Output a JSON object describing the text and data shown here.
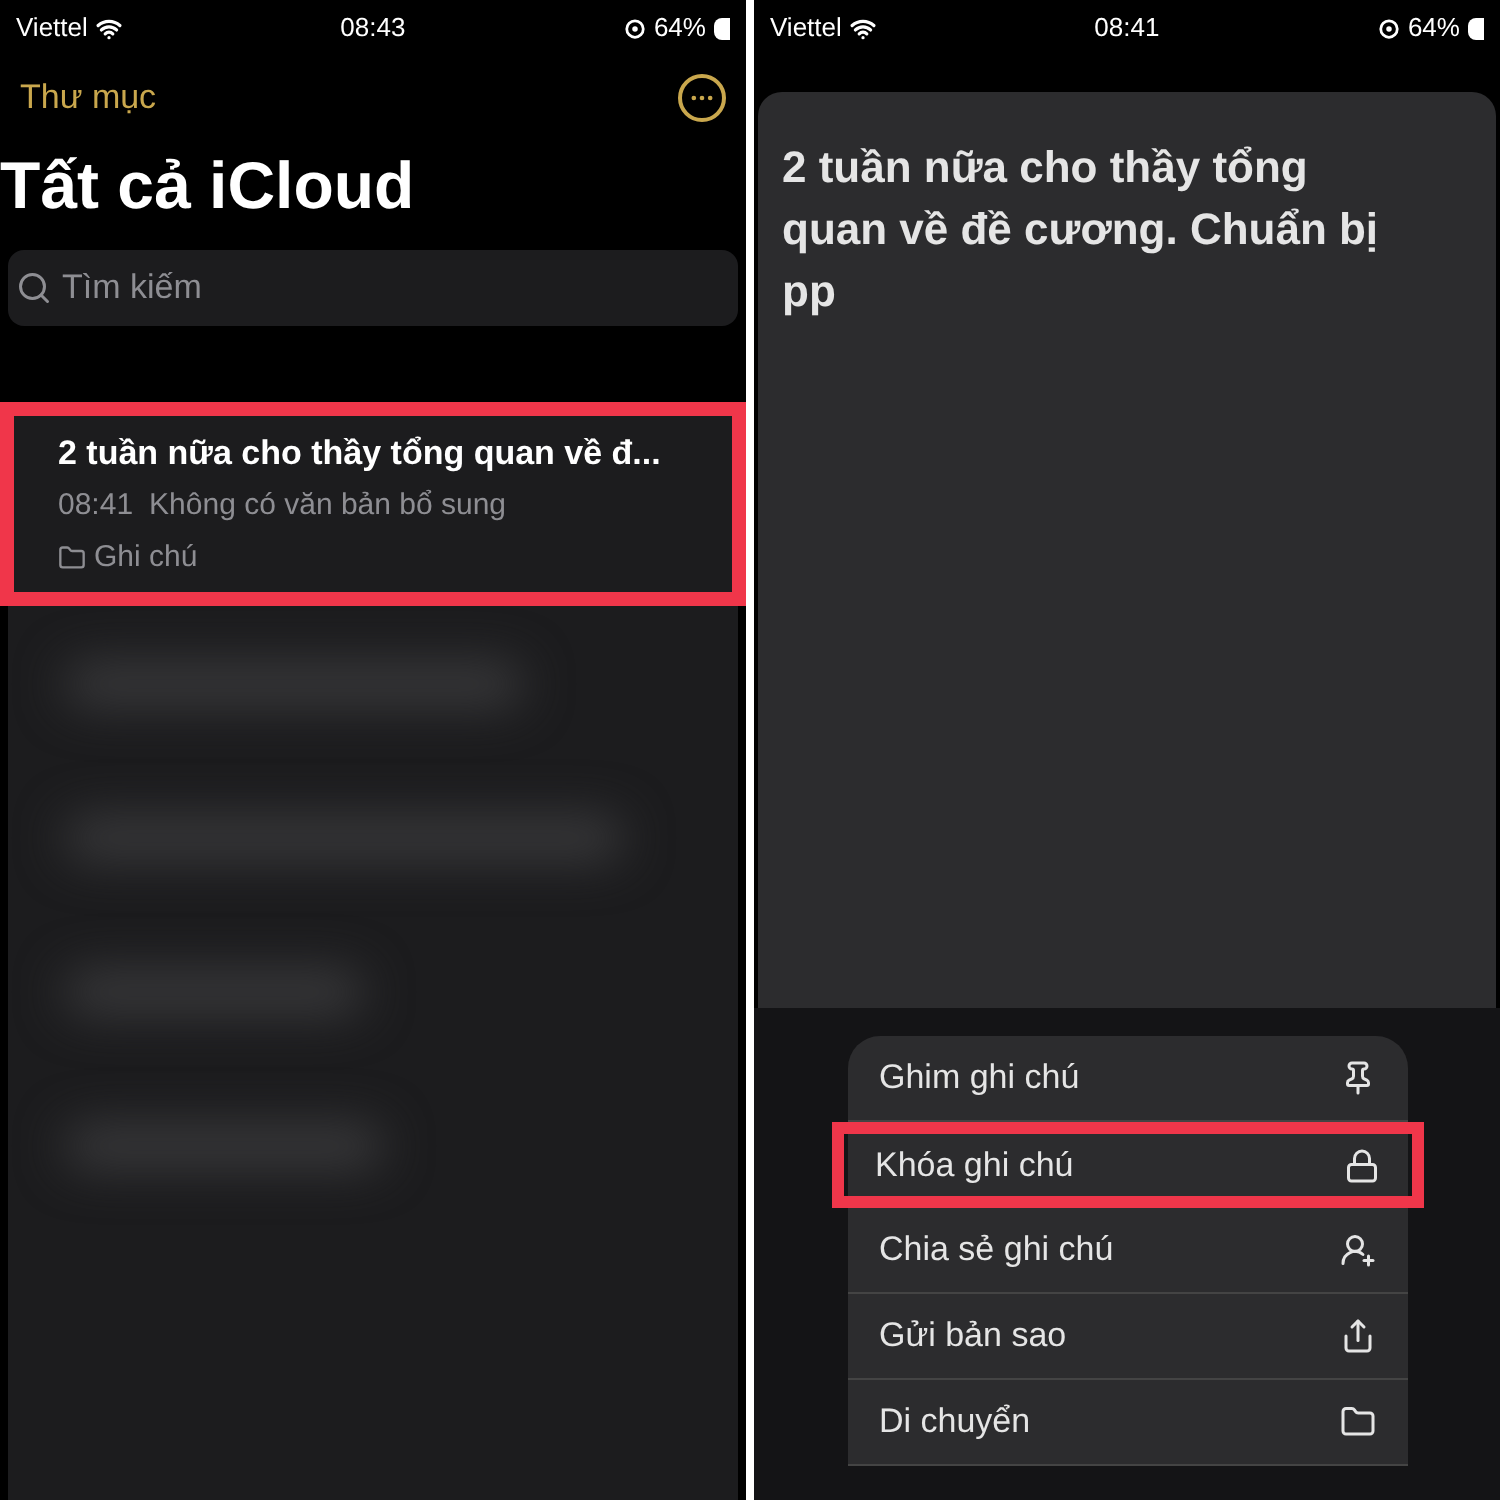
{
  "left_screen": {
    "status_bar": {
      "carrier": "Viettel",
      "time": "08:43",
      "battery": "64%"
    },
    "back_link": "Thư mục",
    "title": "Tất cả iCloud",
    "search": {
      "placeholder": "Tìm kiếm"
    },
    "notes": [
      {
        "title": "2 tuần nữa cho thầy tổng quan về đ...",
        "time": "08:41",
        "preview": "Không có văn bản bổ sung",
        "folder": "Ghi chú",
        "highlighted": true
      }
    ]
  },
  "right_screen": {
    "status_bar": {
      "carrier": "Viettel",
      "time": "08:41",
      "battery": "64%"
    },
    "note_preview": "2 tuần nữa cho thầy tổng quan về đề cương. Chuẩn bị pp",
    "menu": [
      {
        "label": "Ghim ghi chú",
        "kind": "pin",
        "highlighted": false
      },
      {
        "label": "Khóa ghi chú",
        "kind": "lock",
        "highlighted": true
      },
      {
        "label": "Chia sẻ ghi chú",
        "kind": "share-person",
        "highlighted": false
      },
      {
        "label": "Gửi bản sao",
        "kind": "share",
        "highlighted": false
      },
      {
        "label": "Di chuyển",
        "kind": "folder",
        "highlighted": false
      }
    ]
  }
}
